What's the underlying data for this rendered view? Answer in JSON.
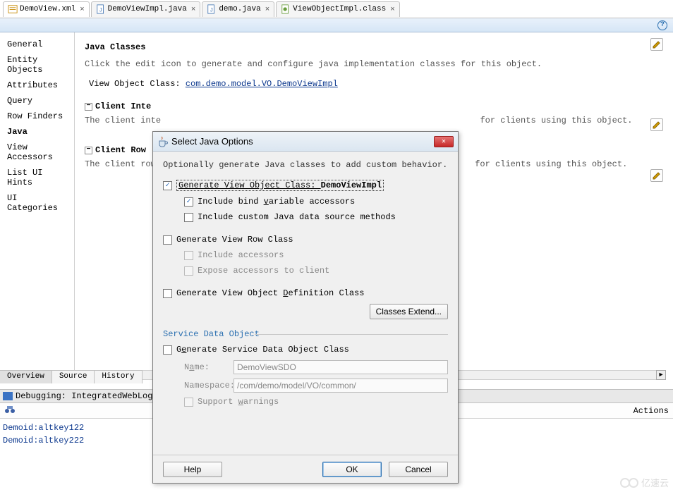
{
  "tabs": [
    {
      "label": "DemoView.xml"
    },
    {
      "label": "DemoViewImpl.java"
    },
    {
      "label": "demo.java"
    },
    {
      "label": "ViewObjectImpl.class"
    }
  ],
  "sidenav": {
    "items": [
      "General",
      "Entity Objects",
      "Attributes",
      "Query",
      "Row Finders",
      "Java",
      "View Accessors",
      "List UI Hints",
      "UI Categories"
    ],
    "selected": "Java"
  },
  "section": {
    "title": "Java Classes",
    "desc": "Click the edit icon to generate and configure java implementation classes for this object.",
    "vo_label": "View Object Class:",
    "vo_link": "com.demo.model.VO.DemoViewImpl",
    "group1_title": "Client Inte",
    "group1_desc_left": "The client inte",
    "group1_desc_right": " for clients using this object.",
    "group2_title": "Client Row ",
    "group2_desc_left": "The client row ",
    "group2_desc_right": " for clients using this object."
  },
  "bottom_tabs": [
    "Overview",
    "Source",
    "History"
  ],
  "debug_bar": "Debugging: IntegratedWebLogicSer",
  "actions_label": "Actions",
  "output": [
    "Demoid:altkey122",
    "Demoid:altkey222"
  ],
  "dialog": {
    "title": "Select Java Options",
    "intro": "Optionally generate Java classes to add custom behavior.",
    "gen_vo_prefix": "Generate View Object Class: ",
    "gen_vo_class": "DemoViewImpl",
    "include_bind": "Include bind variable accessors",
    "include_custom": "Include custom Java data source methods",
    "gen_row": "Generate View Row Class",
    "include_accessors": "Include accessors",
    "expose_accessors": "Expose accessors to client",
    "gen_def": "Generate View Object Definition Class",
    "classes_extend": "Classes Extend...",
    "fieldset_label": "Service Data Object",
    "gen_sdo": "Generate Service Data Object Class",
    "name_label": "Name:",
    "name_value": "DemoViewSDO",
    "ns_label": "Namespace:",
    "ns_value": "/com/demo/model/VO/common/",
    "support_warnings": "Support warnings",
    "help": "Help",
    "ok": "OK",
    "cancel": "Cancel"
  },
  "watermark": "亿速云"
}
